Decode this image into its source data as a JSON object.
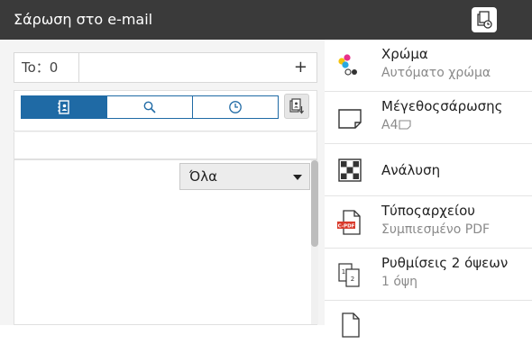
{
  "header": {
    "title": "Σάρωση στο e-mail",
    "job_icon": "job-status-icon"
  },
  "recipients": {
    "to_label": "To：0",
    "add_symbol": "+"
  },
  "address_tabs": [
    {
      "icon": "address-book-icon",
      "active": true
    },
    {
      "icon": "search-icon",
      "active": false
    },
    {
      "icon": "clock-history-icon",
      "active": false
    }
  ],
  "side_button": {
    "icon": "address-book-sort-icon"
  },
  "filter": {
    "selected": "Όλα"
  },
  "settings": [
    {
      "icon": "color-dots-icon",
      "label": "Χρώμα",
      "value": "Αυτόματο χρώμα"
    },
    {
      "icon": "paper-size-icon",
      "label": "Μέγεθοςσάρωσης",
      "value": "A4"
    },
    {
      "icon": "resolution-icon",
      "label": "Ανάλυση"
    },
    {
      "icon": "compact-pdf-icon",
      "label": "Τύποςαρχείου",
      "value": "Συμπιεσμένο PDF"
    },
    {
      "icon": "duplex-icon",
      "label": "Ρυθμίσεις 2 όψεων",
      "value": "1 όψη"
    },
    {
      "icon": "document-icon",
      "label": ""
    }
  ],
  "colors": {
    "titlebar": "#3a3a3a",
    "accent": "#1f6aa5",
    "pdf_red": "#d93a2b"
  }
}
